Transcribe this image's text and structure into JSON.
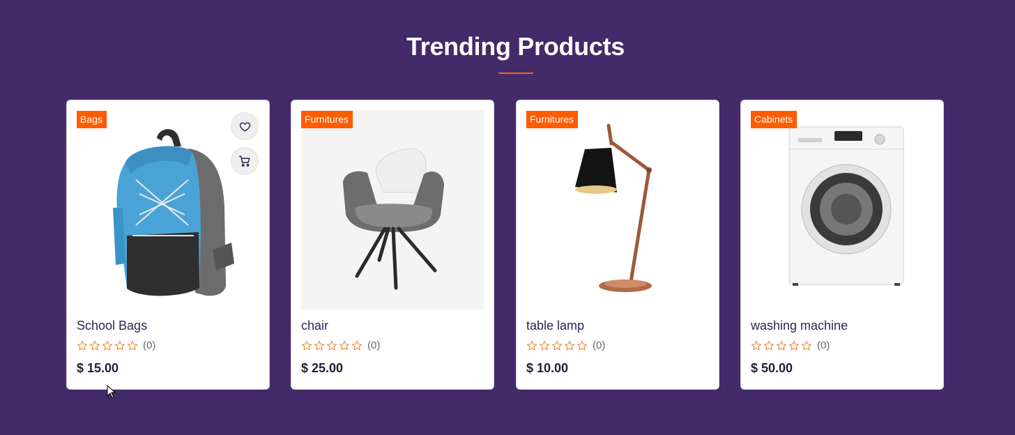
{
  "section": {
    "title": "Trending Products"
  },
  "colors": {
    "background": "#432a69",
    "accent": "#f26522",
    "badge": "#ff5b00",
    "star_outline": "#e08a3a"
  },
  "products": [
    {
      "category": "Bags",
      "name": "School Bags",
      "review_count": "(0)",
      "price": "$ 15.00",
      "rating": 0,
      "image_icon": "backpack-image",
      "actions": [
        "heart-icon",
        "cart-icon"
      ]
    },
    {
      "category": "Furnitures",
      "name": "chair",
      "review_count": "(0)",
      "price": "$ 25.00",
      "rating": 0,
      "image_icon": "chair-image"
    },
    {
      "category": "Furnitures",
      "name": "table lamp",
      "review_count": "(0)",
      "price": "$ 10.00",
      "rating": 0,
      "image_icon": "lamp-image"
    },
    {
      "category": "Cabinets",
      "name": "washing machine",
      "review_count": "(0)",
      "price": "$ 50.00",
      "rating": 0,
      "image_icon": "washing-machine-image"
    }
  ]
}
